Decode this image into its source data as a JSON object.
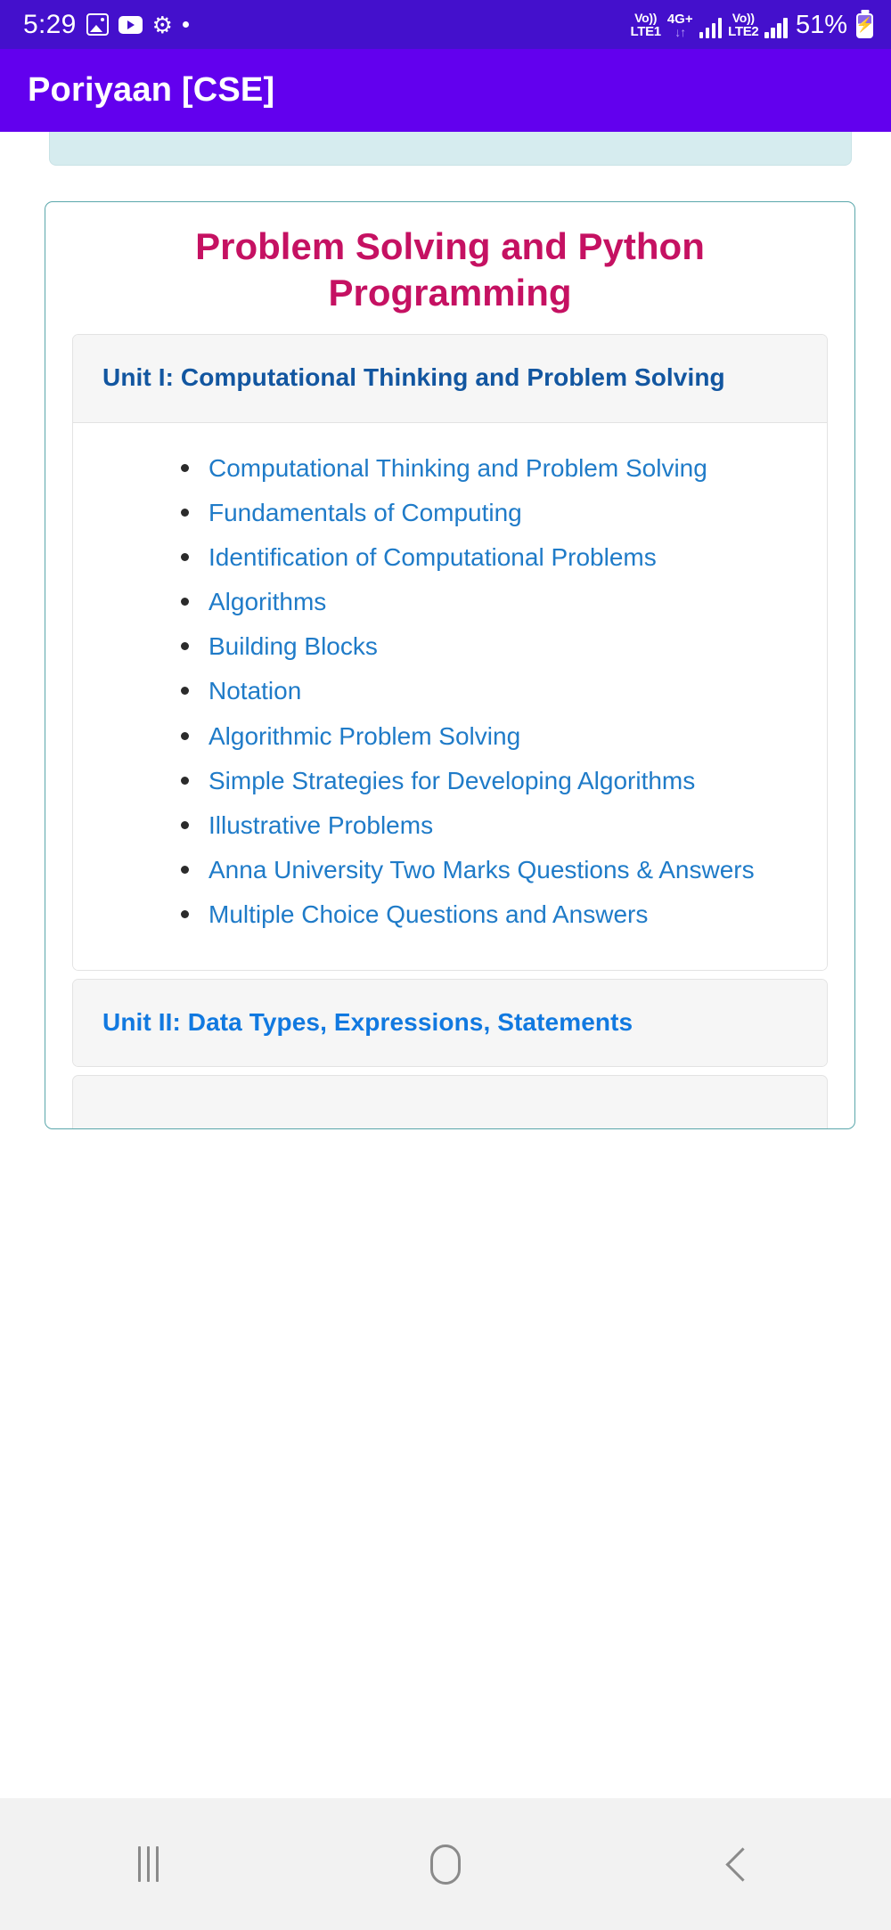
{
  "status_bar": {
    "clock": "5:29",
    "icons": [
      "gallery-icon",
      "youtube-icon",
      "gear-icon",
      "dot-indicator-icon"
    ],
    "sim1_volte": "Vo))",
    "sim1_label": "LTE1",
    "network_type": "4G+",
    "data_arrows": "↓↑",
    "sim2_volte": "Vo))",
    "sim2_label": "LTE2",
    "battery_percent": "51%",
    "battery_state": "charging"
  },
  "app_bar": {
    "title": "Poriyaan [CSE]"
  },
  "content": {
    "course_title": "Problem Solving and Python Programming",
    "units": [
      {
        "heading": "Unit I: Computational Thinking and Problem Solving",
        "topics": [
          "Computational Thinking and Problem Solving",
          "Fundamentals of Computing",
          "Identification of Computational Problems",
          "Algorithms",
          "Building Blocks",
          "Notation",
          "Algorithmic Problem Solving",
          "Simple Strategies for Developing Algorithms",
          "Illustrative Problems",
          "Anna University Two Marks Questions & Answers",
          "Multiple Choice Questions and Answers"
        ]
      },
      {
        "heading": "Unit II: Data Types, Expressions, Statements",
        "topics": []
      }
    ]
  },
  "nav_bar": {
    "recents_label": "Recents",
    "home_label": "Home",
    "back_label": "Back"
  },
  "colors": {
    "app_bar": "#6200EE",
    "status_bar": "#4410CC",
    "course_title": "#C51162",
    "unit1_heading": "#1256A0",
    "unit2_heading": "#1179E0",
    "link": "#1F7BC8",
    "card_border": "#5aa7ab",
    "teal_strip": "#d6ecef"
  }
}
